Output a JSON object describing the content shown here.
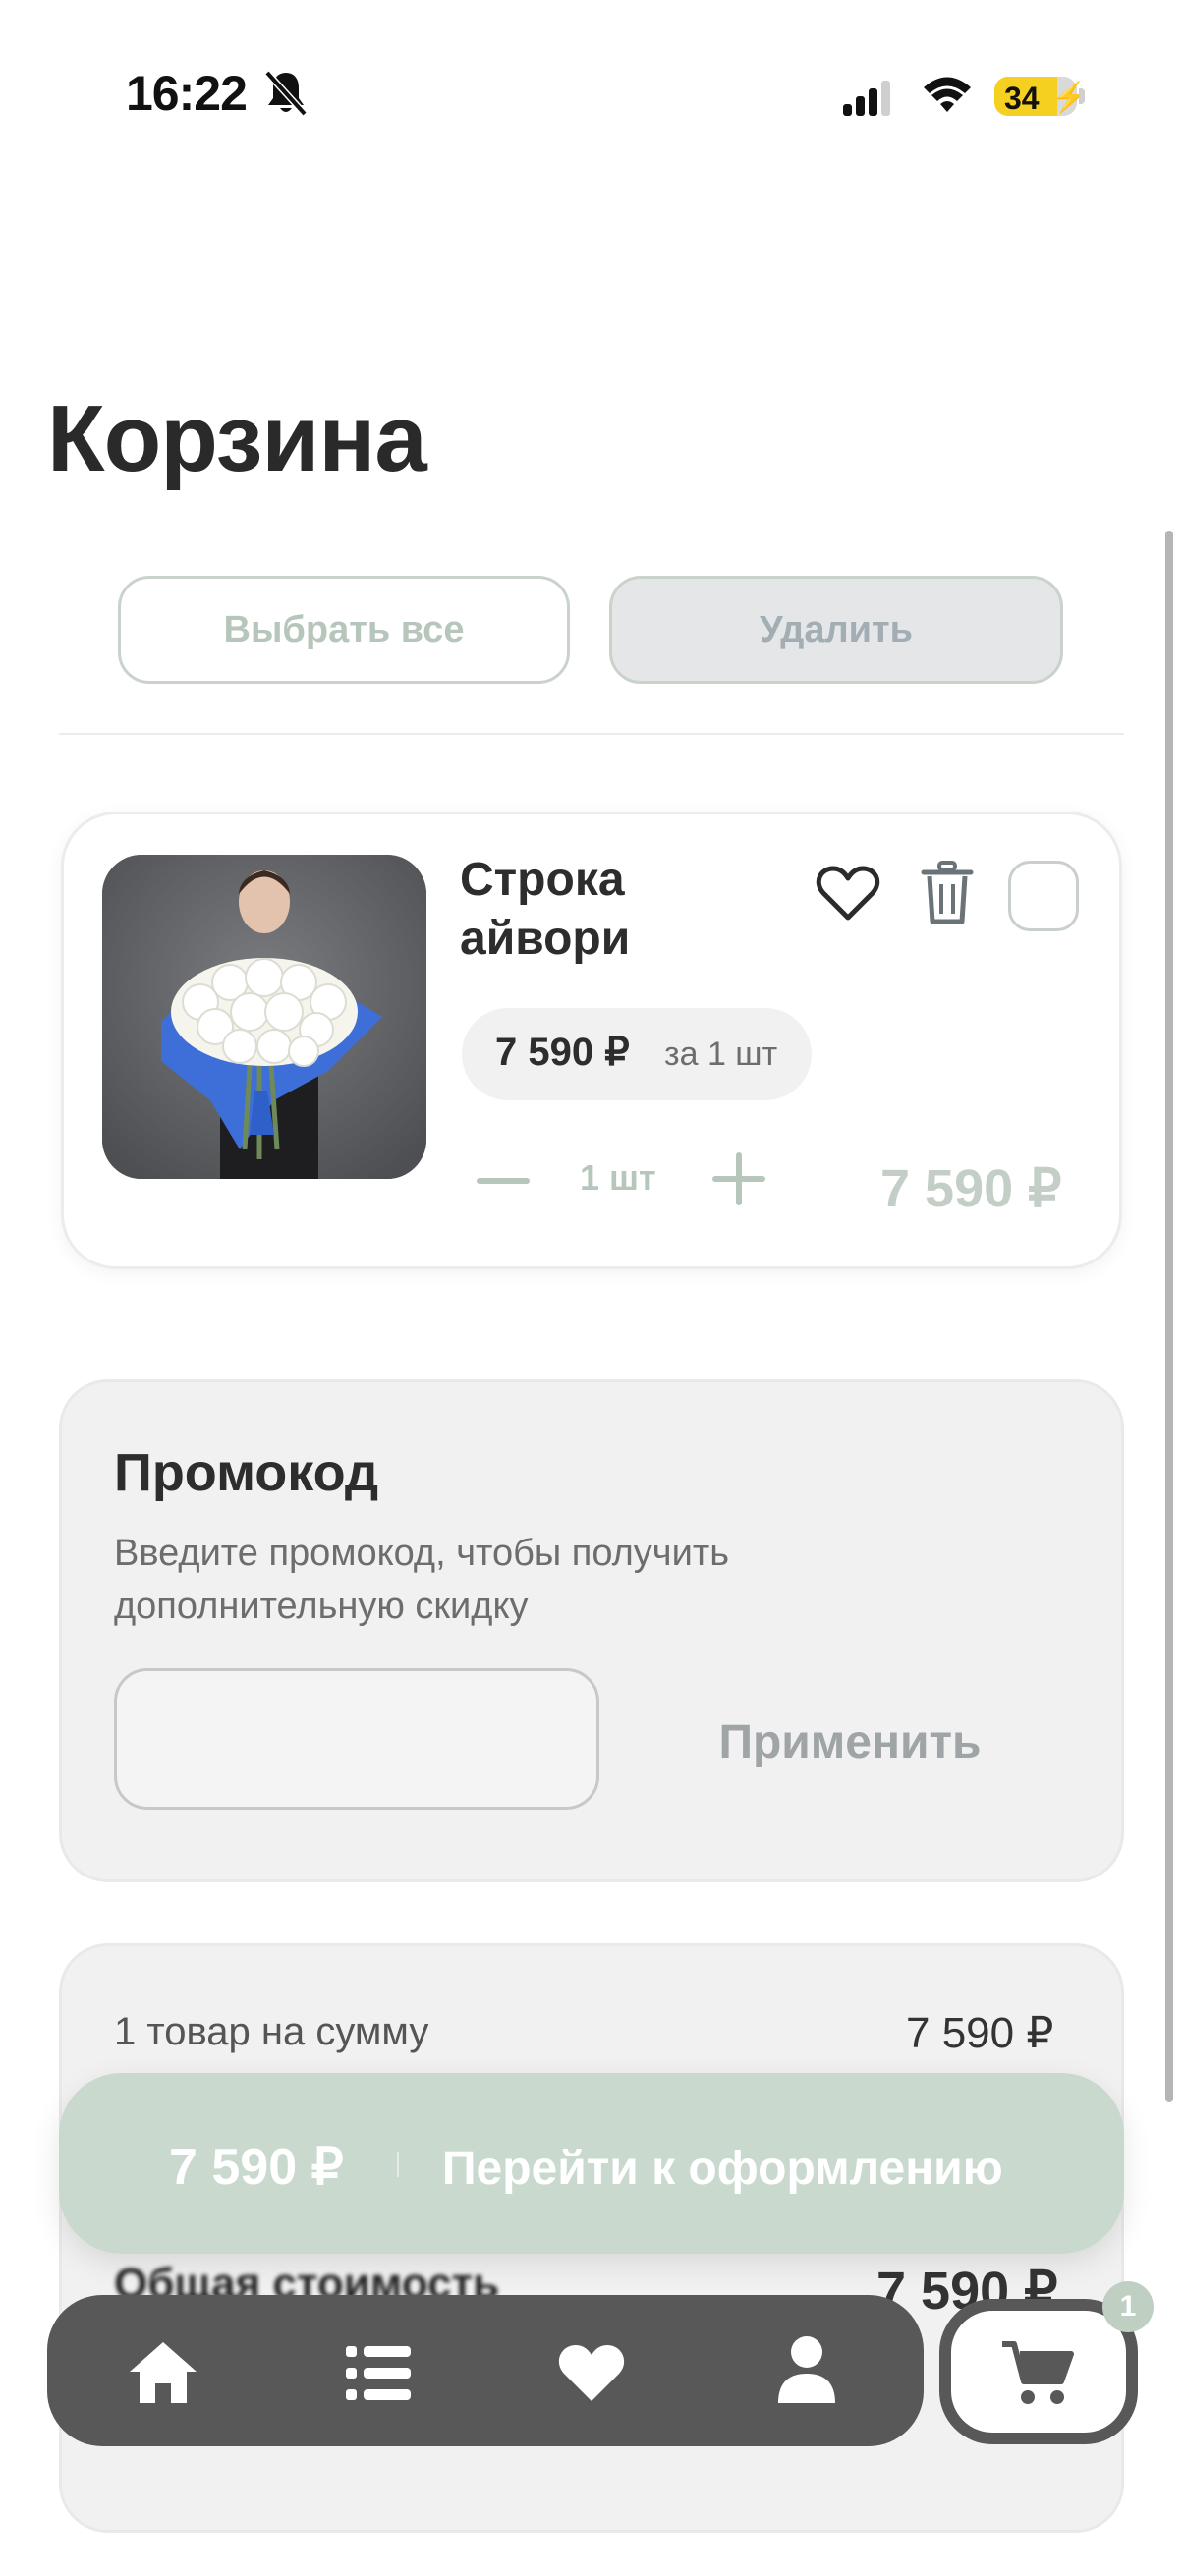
{
  "status_bar": {
    "time": "16:22",
    "battery": "34"
  },
  "page": {
    "title": "Корзина"
  },
  "actions": {
    "select_all": "Выбрать все",
    "delete": "Удалить"
  },
  "cart_items": [
    {
      "name": "Строка айвори",
      "unit_price": "7 590 ₽",
      "unit_label": "за 1 шт",
      "quantity": "1 шт",
      "line_total": "7 590 ₽",
      "selected": false
    }
  ],
  "promo": {
    "title": "Промокод",
    "description": "Введите промокод, чтобы получить дополнительную скидку",
    "input_value": "",
    "apply_label": "Применить"
  },
  "summary": {
    "items_label": "1 товар на сумму",
    "items_value": "7 590 ₽",
    "total_label": "Общая стоимость",
    "total_value": "7 590 ₽"
  },
  "checkout": {
    "price": "7 590 ₽",
    "label": "Перейти к оформлению"
  },
  "nav": {
    "items": [
      "home-icon",
      "list-icon",
      "heart-icon",
      "user-icon",
      "cart-icon"
    ],
    "cart_badge": "1"
  },
  "colors": {
    "accent": "#c4d6ca",
    "accent_text": "#b7c6ba",
    "nav_bg": "#585858",
    "card_bg": "#f1f1f1"
  }
}
